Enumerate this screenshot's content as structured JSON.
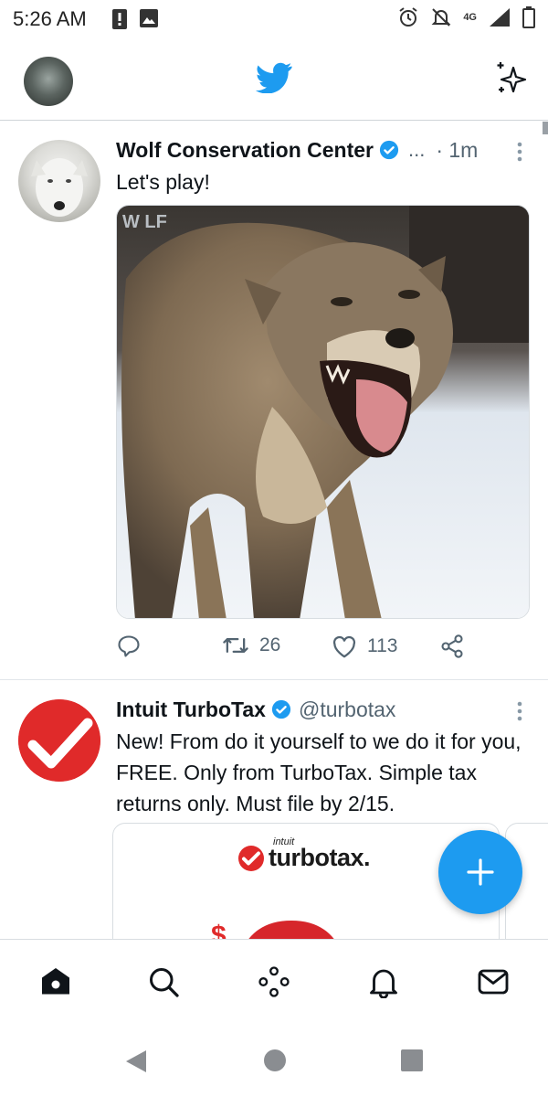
{
  "status_bar": {
    "time": "5:26 AM",
    "network": "4G"
  },
  "header": {
    "logo": "twitter-bird-icon"
  },
  "tweets": [
    {
      "name": "Wolf Conservation Center",
      "verified": true,
      "handle_truncated": "...",
      "time": "· 1m",
      "text": "Let's play!",
      "media": "wolf-photo",
      "retweets": "26",
      "likes": "113"
    },
    {
      "name": "Intuit TurboTax",
      "verified": true,
      "handle": "@turbotax",
      "text": "New! From do it yourself to we do it for you, FREE. Only from TurboTax. Simple tax returns only. Must file by 2/15.",
      "card": {
        "brand_small": "intuit",
        "brand": "turbotax."
      }
    }
  ],
  "colors": {
    "twitter_blue": "#1d9bf0",
    "turbotax_red": "#e02a2a",
    "secondary_text": "#536471"
  },
  "bottom_nav": [
    "home-icon",
    "search-icon",
    "spaces-icon",
    "notifications-icon",
    "messages-icon"
  ],
  "system_nav": [
    "back-icon",
    "home-circle-icon",
    "recents-icon"
  ]
}
